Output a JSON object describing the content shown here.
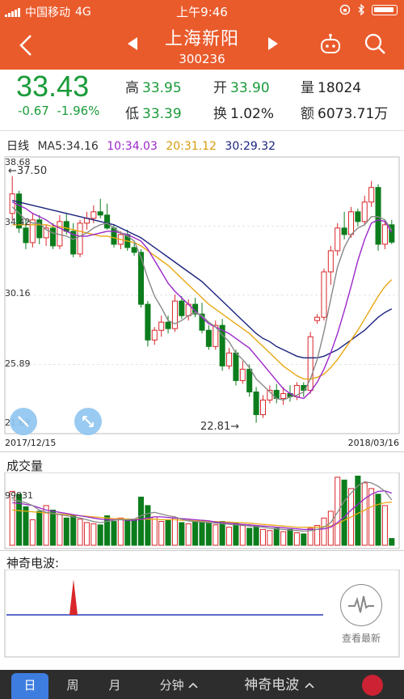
{
  "status": {
    "carrier": "中国移动",
    "network": "4G",
    "time": "上午9:46"
  },
  "nav": {
    "title": "上海新阳",
    "code": "300236"
  },
  "quote": {
    "price": "33.43",
    "change": "-0.67",
    "change_pct": "-1.96%",
    "high_label": "高",
    "high": "33.95",
    "low_label": "低",
    "low": "33.39",
    "open_label": "开",
    "open": "33.90",
    "turnover_label": "换",
    "turnover": "1.02%",
    "volume_label": "量",
    "volume": "18024",
    "amount_label": "额",
    "amount": "6073.71万"
  },
  "kline": {
    "period": "日线",
    "ma5": "MA5:34.16",
    "ma10": "10:34.03",
    "ma20": "20:31.12",
    "ma30": "30:29.32",
    "y_labels": [
      "38.68",
      "34.42",
      "30.16",
      "25.89",
      "21.63"
    ],
    "high_marker": "←37.50",
    "low_marker": "22.81→",
    "date_start": "2017/12/15",
    "date_end": "2018/03/16",
    "colors": {
      "up": "#d9262a",
      "down": "#0c7d1c",
      "ma5": "#888888",
      "ma10": "#9b27c9",
      "ma20": "#e8a814",
      "ma30": "#1a237e"
    }
  },
  "volume": {
    "title": "成交量",
    "max_label": "99831"
  },
  "magic": {
    "title": "神奇电波:",
    "latest_label": "查看最新"
  },
  "tabs": {
    "day": "日",
    "week": "周",
    "month": "月",
    "minute": "分钟",
    "magic": "神奇电波"
  },
  "chart_data": [
    {
      "type": "candlestick",
      "title": "日线",
      "x_range": [
        "2017/12/15",
        "2018/03/16"
      ],
      "ylim": [
        21.63,
        38.68
      ],
      "ohlc": [
        [
          35.2,
          37.5,
          34.8,
          36.4
        ],
        [
          36.4,
          36.6,
          34.0,
          34.3
        ],
        [
          34.3,
          34.8,
          33.0,
          33.4
        ],
        [
          33.4,
          35.2,
          33.1,
          34.8
        ],
        [
          34.8,
          35.1,
          33.3,
          33.7
        ],
        [
          33.7,
          34.5,
          33.2,
          34.3
        ],
        [
          34.3,
          34.6,
          33.0,
          33.2
        ],
        [
          33.2,
          35.1,
          33.0,
          34.7
        ],
        [
          34.7,
          35.2,
          33.9,
          34.1
        ],
        [
          34.1,
          34.6,
          32.5,
          32.7
        ],
        [
          32.7,
          34.8,
          32.5,
          34.6
        ],
        [
          34.6,
          35.3,
          34.2,
          34.9
        ],
        [
          34.9,
          35.7,
          34.6,
          35.3
        ],
        [
          35.3,
          36.1,
          34.9,
          35.1
        ],
        [
          35.1,
          35.8,
          34.2,
          34.3
        ],
        [
          34.3,
          34.5,
          33.1,
          33.3
        ],
        [
          33.3,
          34.1,
          33.0,
          33.9
        ],
        [
          33.9,
          34.2,
          32.9,
          33.1
        ],
        [
          33.1,
          33.4,
          32.6,
          32.8
        ],
        [
          32.8,
          33.0,
          29.4,
          29.6
        ],
        [
          29.6,
          29.8,
          27.0,
          27.4
        ],
        [
          27.4,
          28.2,
          27.1,
          28.0
        ],
        [
          28.0,
          28.9,
          27.6,
          28.5
        ],
        [
          28.5,
          28.9,
          27.8,
          28.1
        ],
        [
          28.1,
          30.2,
          27.9,
          29.8
        ],
        [
          29.8,
          30.1,
          28.7,
          28.9
        ],
        [
          28.9,
          29.9,
          28.6,
          29.6
        ],
        [
          29.6,
          30.0,
          28.8,
          29.0
        ],
        [
          29.0,
          29.7,
          27.8,
          28.0
        ],
        [
          28.0,
          28.3,
          26.8,
          27.0
        ],
        [
          27.0,
          28.6,
          26.8,
          28.3
        ],
        [
          28.3,
          28.7,
          25.5,
          25.8
        ],
        [
          25.8,
          26.9,
          25.6,
          26.6
        ],
        [
          26.6,
          26.8,
          24.6,
          24.9
        ],
        [
          24.9,
          26.1,
          24.7,
          25.6
        ],
        [
          25.6,
          25.9,
          23.9,
          24.2
        ],
        [
          24.2,
          24.5,
          22.3,
          22.8
        ],
        [
          22.8,
          24.0,
          22.6,
          23.7
        ],
        [
          23.7,
          24.6,
          23.5,
          24.3
        ],
        [
          24.3,
          24.7,
          23.5,
          23.8
        ],
        [
          23.8,
          24.5,
          23.4,
          24.1
        ],
        [
          24.1,
          24.6,
          23.6,
          23.9
        ],
        [
          23.9,
          24.8,
          23.7,
          24.6
        ],
        [
          24.6,
          24.8,
          23.9,
          24.3
        ],
        [
          24.3,
          27.9,
          24.1,
          27.6
        ],
        [
          28.6,
          29.0,
          28.4,
          28.8
        ],
        [
          28.8,
          31.8,
          28.6,
          31.6
        ],
        [
          31.6,
          33.2,
          30.8,
          32.9
        ],
        [
          32.9,
          34.6,
          32.6,
          34.3
        ],
        [
          34.3,
          35.3,
          33.6,
          33.9
        ],
        [
          33.9,
          35.6,
          33.7,
          35.3
        ],
        [
          35.3,
          35.5,
          34.4,
          34.7
        ],
        [
          34.7,
          36.3,
          34.5,
          35.9
        ],
        [
          35.9,
          37.2,
          35.6,
          36.8
        ],
        [
          36.8,
          37.0,
          32.9,
          33.3
        ],
        [
          33.3,
          34.8,
          33.0,
          34.5
        ],
        [
          34.5,
          34.8,
          33.3,
          33.43
        ]
      ],
      "ma5": [
        35.6,
        35.2,
        34.8,
        34.6,
        34.6,
        34.2,
        34.0,
        33.9,
        33.8,
        33.6,
        33.8,
        34.0,
        34.3,
        34.5,
        34.6,
        34.3,
        34.0,
        33.8,
        33.5,
        32.5,
        31.2,
        30.1,
        29.4,
        28.6,
        28.4,
        28.6,
        28.9,
        29.1,
        28.9,
        28.5,
        28.2,
        27.7,
        27.3,
        26.6,
        26.2,
        25.7,
        25.0,
        24.6,
        24.2,
        23.8,
        23.7,
        23.9,
        24.0,
        24.2,
        25.0,
        26.2,
        27.9,
        29.9,
        31.9,
        33.1,
        33.9,
        34.3,
        34.5,
        35.0,
        35.0,
        34.8,
        34.16
      ],
      "ma10": [
        35.9,
        35.7,
        35.5,
        35.2,
        35.0,
        34.8,
        34.5,
        34.3,
        34.1,
        33.9,
        33.8,
        33.8,
        33.9,
        34.0,
        34.1,
        34.1,
        34.0,
        33.9,
        33.7,
        33.5,
        33.0,
        32.3,
        31.6,
        30.9,
        30.4,
        30.0,
        29.6,
        29.2,
        28.8,
        28.4,
        28.2,
        28.0,
        27.8,
        27.5,
        27.2,
        26.9,
        26.4,
        25.9,
        25.4,
        24.9,
        24.4,
        24.1,
        23.9,
        23.8,
        24.2,
        24.8,
        25.6,
        26.6,
        27.8,
        29.2,
        30.7,
        32.3,
        33.6,
        34.6,
        34.8,
        34.7,
        34.03
      ],
      "ma20": [
        34.5,
        34.5,
        34.5,
        34.5,
        34.5,
        34.5,
        34.4,
        34.4,
        34.3,
        34.2,
        34.1,
        34.0,
        33.9,
        33.8,
        33.8,
        33.7,
        33.6,
        33.5,
        33.4,
        33.2,
        32.9,
        32.6,
        32.3,
        32.0,
        31.6,
        31.2,
        30.8,
        30.4,
        30.0,
        29.6,
        29.3,
        29.0,
        28.7,
        28.4,
        28.1,
        27.8,
        27.4,
        27.0,
        26.6,
        26.2,
        25.8,
        25.5,
        25.2,
        25.0,
        25.0,
        25.1,
        25.3,
        25.7,
        26.2,
        26.8,
        27.4,
        28.0,
        28.7,
        29.4,
        30.1,
        30.7,
        31.12
      ],
      "ma30": [
        36.0,
        35.9,
        35.8,
        35.7,
        35.6,
        35.5,
        35.4,
        35.3,
        35.2,
        35.1,
        35.0,
        34.9,
        34.8,
        34.7,
        34.6,
        34.5,
        34.3,
        34.1,
        33.9,
        33.7,
        33.4,
        33.1,
        32.8,
        32.5,
        32.2,
        31.9,
        31.6,
        31.3,
        31.0,
        30.6,
        30.2,
        29.8,
        29.4,
        29.0,
        28.6,
        28.2,
        27.8,
        27.5,
        27.3,
        27.0,
        26.8,
        26.6,
        26.4,
        26.3,
        26.3,
        26.3,
        26.4,
        26.6,
        26.8,
        27.1,
        27.4,
        27.7,
        28.0,
        28.4,
        28.8,
        29.1,
        29.32
      ]
    },
    {
      "type": "bar",
      "title": "成交量",
      "ymax": 99831,
      "values": [
        95000,
        90000,
        68000,
        45000,
        60000,
        70000,
        62000,
        55000,
        48000,
        52000,
        46000,
        40000,
        38000,
        36000,
        52000,
        42000,
        48000,
        44000,
        46000,
        85000,
        70000,
        50000,
        42000,
        45000,
        48000,
        40000,
        38000,
        42000,
        44000,
        40000,
        36000,
        42000,
        32000,
        40000,
        36000,
        30000,
        34000,
        28000,
        26000,
        30000,
        24000,
        28000,
        22000,
        20000,
        30000,
        35000,
        48000,
        60000,
        120000,
        115000,
        100000,
        122000,
        110000,
        100000,
        90000,
        70000,
        12000
      ],
      "ma5": [
        80000,
        78000,
        75000,
        70000,
        62000,
        58000,
        56000,
        54000,
        52000,
        50000,
        48000,
        45000,
        42000,
        40000,
        42000,
        44000,
        45000,
        45000,
        46000,
        52000,
        56000,
        58000,
        55000,
        52000,
        50000,
        46000,
        43000,
        42000,
        41000,
        40000,
        39000,
        38000,
        37000,
        36000,
        35000,
        34000,
        33000,
        32000,
        30000,
        29000,
        28000,
        27000,
        26000,
        25000,
        26000,
        28000,
        32000,
        40000,
        58000,
        78000,
        92000,
        105000,
        112000,
        110000,
        104000,
        95000,
        80000
      ],
      "ma10": [
        75000,
        74000,
        72000,
        70000,
        66000,
        62000,
        60000,
        58000,
        56000,
        54000,
        52000,
        50000,
        48000,
        46000,
        45000,
        45000,
        45000,
        44000,
        44000,
        46000,
        48000,
        50000,
        50000,
        49000,
        48000,
        47000,
        46000,
        45000,
        44000,
        43000,
        41000,
        40000,
        39000,
        38000,
        37000,
        36000,
        35000,
        34000,
        33000,
        32000,
        31000,
        30000,
        29000,
        28000,
        28000,
        28000,
        29000,
        32000,
        40000,
        50000,
        62000,
        72000,
        82000,
        90000,
        95000,
        96000,
        92000
      ],
      "ma20": [
        62000,
        61000,
        60000,
        59000,
        58000,
        57000,
        56000,
        55000,
        54000,
        53000,
        52000,
        51000,
        50000,
        49000,
        48000,
        47000,
        47000,
        46000,
        46000,
        46000,
        46000,
        46000,
        45000,
        45000,
        45000,
        44000,
        44000,
        43000,
        43000,
        42000,
        42000,
        41000,
        41000,
        40000,
        40000,
        39000,
        38000,
        37000,
        36000,
        35000,
        34000,
        33000,
        32000,
        32000,
        32000,
        32000,
        33000,
        34000,
        38000,
        44000,
        50000,
        56000,
        62000,
        68000,
        72000,
        75000,
        76000
      ]
    }
  ]
}
